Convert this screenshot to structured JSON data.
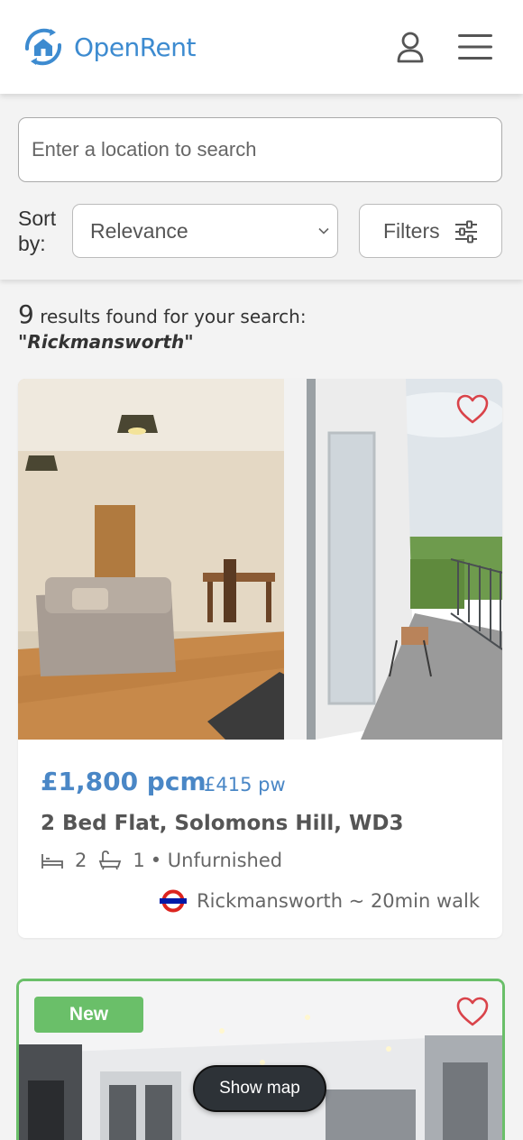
{
  "header": {
    "brand": "OpenRent",
    "brand_color": "#3d8bd0",
    "user_icon": "user-icon",
    "menu_icon": "hamburger-menu-icon"
  },
  "search": {
    "placeholder": "Enter a location to search",
    "value": "",
    "sort_label": "Sort by:",
    "sort_selected": "Relevance",
    "filters_label": "Filters"
  },
  "results": {
    "count": "9",
    "text": "results found for your search:",
    "query": "\"Rickmansworth\""
  },
  "listings": [
    {
      "price": "£1,800 pcm",
      "price_weekly": "£415 pw",
      "title": "2 Bed Flat, Solomons Hill, WD3",
      "beds": "2",
      "baths": "1",
      "furnishing": "• Unfurnished",
      "station": "Rickmansworth ~ 20min walk",
      "favourited": false
    },
    {
      "badge": "New",
      "badge_color": "#6abf69",
      "favourited": false
    }
  ],
  "show_map_label": "Show map",
  "colors": {
    "accent": "#4a87c6",
    "favourite": "#d9434a",
    "new_badge": "#6abf69"
  }
}
